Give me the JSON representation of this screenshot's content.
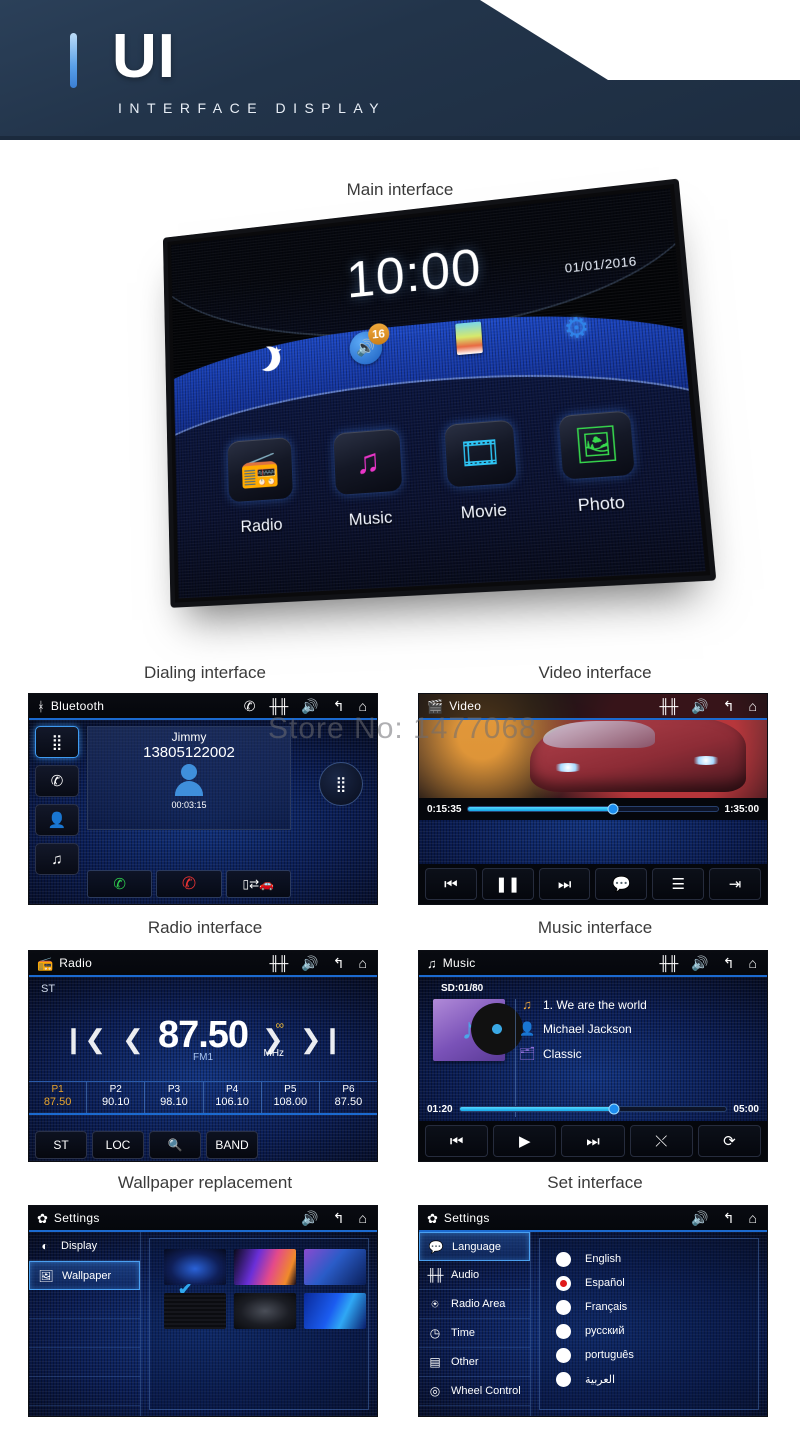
{
  "header": {
    "title": "UI",
    "subtitle": "INTERFACE DISPLAY",
    "accent_color": "#5aa0e8",
    "background_color": "#22344a"
  },
  "watermark": {
    "text": "Store No: 1477068"
  },
  "sections": {
    "main": "Main interface",
    "dialing": "Dialing interface",
    "video": "Video interface",
    "radio": "Radio interface",
    "music": "Music interface",
    "wallpaper": "Wallpaper replacement",
    "settings": "Set interface"
  },
  "main_interface": {
    "time": "10:00",
    "date": "01/01/2016",
    "status_icons": [
      {
        "name": "moon-star-icon",
        "glyph": "★"
      },
      {
        "name": "volume-icon",
        "glyph": "🔊",
        "badge": "16"
      },
      {
        "name": "wallpaper-icon",
        "glyph": ""
      },
      {
        "name": "gear-icon",
        "glyph": "⚙"
      }
    ],
    "apps": [
      {
        "label": "Radio",
        "icon": "radio-icon",
        "glyph": "📻",
        "color": "#f4c21b"
      },
      {
        "label": "Music",
        "icon": "music-note-icon",
        "glyph": "♫",
        "color": "#e935c8"
      },
      {
        "label": "Movie",
        "icon": "film-strip-icon",
        "glyph": "🎞",
        "color": "#2ec5f5"
      },
      {
        "label": "Photo",
        "icon": "photo-icon",
        "glyph": "🖼",
        "color": "#37d94d"
      }
    ]
  },
  "dialing": {
    "title": "Bluetooth",
    "title_icon": "bluetooth-icon",
    "toolbar": [
      {
        "name": "phone-connected-icon",
        "glyph": "✆"
      },
      {
        "name": "equalizer-icon",
        "glyph": "↑↑↑"
      },
      {
        "name": "volume-icon",
        "glyph": "🔊"
      },
      {
        "name": "back-icon",
        "glyph": "↶"
      },
      {
        "name": "home-icon",
        "glyph": "⌂"
      }
    ],
    "sidebar": [
      {
        "name": "keypad-icon",
        "glyph": "∷",
        "selected": true
      },
      {
        "name": "call-history-icon",
        "glyph": "✆"
      },
      {
        "name": "contacts-icon",
        "glyph": "👤"
      },
      {
        "name": "music-icon",
        "glyph": "♫"
      }
    ],
    "contact_name": "Jimmy",
    "phone_number": "13805122002",
    "call_duration": "00:03:15",
    "actions": [
      {
        "name": "answer-call-button",
        "glyph": "✆"
      },
      {
        "name": "end-call-button",
        "glyph": "✆"
      },
      {
        "name": "transfer-audio-button",
        "glyph": "⬌"
      }
    ],
    "keypad_button": "keypad-round-button"
  },
  "video": {
    "title": "Video",
    "title_icon": "video-camera-icon",
    "toolbar": [
      {
        "name": "equalizer-icon",
        "glyph": "↑↑↑"
      },
      {
        "name": "volume-icon",
        "glyph": "🔊"
      },
      {
        "name": "back-icon",
        "glyph": "↶"
      },
      {
        "name": "home-icon",
        "glyph": "⌂"
      }
    ],
    "current_time": "0:15:35",
    "total_time": "1:35:00",
    "progress_percent": 58,
    "controls": [
      {
        "name": "previous-button",
        "glyph": "⏮"
      },
      {
        "name": "pause-button",
        "glyph": "⏸"
      },
      {
        "name": "next-button",
        "glyph": "⏭"
      },
      {
        "name": "subtitle-button",
        "glyph": "💬"
      },
      {
        "name": "playlist-button",
        "glyph": "☰"
      },
      {
        "name": "aspect-ratio-button",
        "glyph": "⇄"
      }
    ]
  },
  "radio": {
    "title": "Radio",
    "title_icon": "radio-icon",
    "toolbar": [
      {
        "name": "equalizer-icon",
        "glyph": "↑↑↑"
      },
      {
        "name": "volume-icon",
        "glyph": "🔊"
      },
      {
        "name": "back-icon",
        "glyph": "↶"
      },
      {
        "name": "home-icon",
        "glyph": "⌂"
      }
    ],
    "stereo_indicator": "ST",
    "frequency": "87.50",
    "unit": "MHz",
    "band": "FM1",
    "stereo_glyph": "∞",
    "nav": [
      {
        "name": "seek-prev-button",
        "glyph": "❘‹"
      },
      {
        "name": "tune-down-button",
        "glyph": "‹"
      },
      {
        "name": "tune-up-button",
        "glyph": "›"
      },
      {
        "name": "seek-next-button",
        "glyph": "›❘"
      }
    ],
    "presets": [
      {
        "label": "P1",
        "value": "87.50",
        "active": true
      },
      {
        "label": "P2",
        "value": "90.10",
        "active": false
      },
      {
        "label": "P3",
        "value": "98.10",
        "active": false
      },
      {
        "label": "P4",
        "value": "106.10",
        "active": false
      },
      {
        "label": "P5",
        "value": "108.00",
        "active": false
      },
      {
        "label": "P6",
        "value": "87.50",
        "active": false
      }
    ],
    "buttons": [
      {
        "name": "st-button",
        "label": "ST"
      },
      {
        "name": "loc-button",
        "label": "LOC"
      },
      {
        "name": "search-button",
        "label": "🔍"
      },
      {
        "name": "band-button",
        "label": "BAND"
      }
    ]
  },
  "music": {
    "title": "Music",
    "title_icon": "music-note-icon",
    "toolbar": [
      {
        "name": "equalizer-icon",
        "glyph": "↑↑↑"
      },
      {
        "name": "volume-icon",
        "glyph": "🔊"
      },
      {
        "name": "back-icon",
        "glyph": "↶"
      },
      {
        "name": "home-icon",
        "glyph": "⌂"
      }
    ],
    "source": "SD:01/80",
    "track_title": "1.  We are the world",
    "artist": "Michael Jackson",
    "genre": "Classic",
    "track_icon": "music-note-icon",
    "artist_icon": "person-icon",
    "genre_icon": "folder-music-icon",
    "current_time": "01:20",
    "total_time": "05:00",
    "progress_percent": 58,
    "controls": [
      {
        "name": "previous-track-button",
        "glyph": "⏮"
      },
      {
        "name": "play-button",
        "glyph": "▶"
      },
      {
        "name": "next-track-button",
        "glyph": "⏭"
      },
      {
        "name": "shuffle-button",
        "glyph": "⤮"
      },
      {
        "name": "repeat-button",
        "glyph": "↻"
      }
    ]
  },
  "wallpaper_settings": {
    "title": "Settings",
    "title_icon": "gear-icon",
    "toolbar": [
      {
        "name": "volume-icon",
        "glyph": "🔊"
      },
      {
        "name": "back-icon",
        "glyph": "↶"
      },
      {
        "name": "home-icon",
        "glyph": "⌂"
      }
    ],
    "menu": [
      {
        "label": "Display",
        "icon": "contrast-icon",
        "glyph": "◐",
        "selected": false
      },
      {
        "label": "Wallpaper",
        "icon": "image-icon",
        "glyph": "🖻",
        "selected": true
      },
      {
        "label": "",
        "icon": "",
        "glyph": "",
        "selected": false
      },
      {
        "label": "",
        "icon": "",
        "glyph": "",
        "selected": false
      },
      {
        "label": "",
        "icon": "",
        "glyph": "",
        "selected": false
      },
      {
        "label": "",
        "icon": "",
        "glyph": "",
        "selected": false
      }
    ],
    "thumbnails": [
      {
        "name": "wallpaper-thumb-1",
        "selected": true
      },
      {
        "name": "wallpaper-thumb-2",
        "selected": false
      },
      {
        "name": "wallpaper-thumb-3",
        "selected": false
      },
      {
        "name": "wallpaper-thumb-4",
        "selected": false
      },
      {
        "name": "wallpaper-thumb-5",
        "selected": false
      },
      {
        "name": "wallpaper-thumb-6",
        "selected": false
      }
    ]
  },
  "language_settings": {
    "title": "Settings",
    "title_icon": "gear-icon",
    "toolbar": [
      {
        "name": "volume-icon",
        "glyph": "🔊"
      },
      {
        "name": "back-icon",
        "glyph": "↶"
      },
      {
        "name": "home-icon",
        "glyph": "⌂"
      }
    ],
    "menu": [
      {
        "label": "Language",
        "icon": "speech-bubble-icon",
        "glyph": "💬",
        "selected": true
      },
      {
        "label": "Audio",
        "icon": "equalizer-icon",
        "glyph": "↑↑↑",
        "selected": false
      },
      {
        "label": "Radio Area",
        "icon": "antenna-icon",
        "glyph": "☁",
        "selected": false
      },
      {
        "label": "Time",
        "icon": "clock-icon",
        "glyph": "◷",
        "selected": false
      },
      {
        "label": "Other",
        "icon": "grid-icon",
        "glyph": "☷",
        "selected": false
      },
      {
        "label": "Wheel Control",
        "icon": "steering-wheel-icon",
        "glyph": "☸",
        "selected": false
      }
    ],
    "languages": [
      {
        "label": "English",
        "selected": false
      },
      {
        "label": "Español",
        "selected": true
      },
      {
        "label": "Français",
        "selected": false
      },
      {
        "label": "русский",
        "selected": false
      },
      {
        "label": "português",
        "selected": false
      },
      {
        "label": "العربية",
        "selected": false
      }
    ]
  }
}
